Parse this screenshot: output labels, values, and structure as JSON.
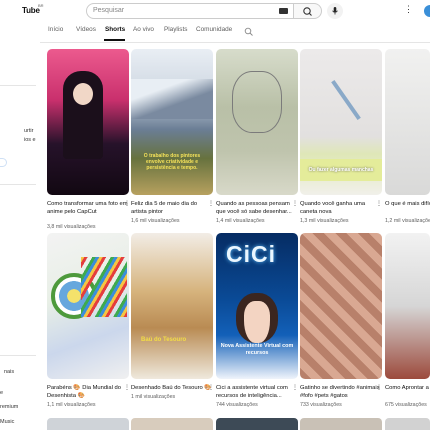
{
  "header": {
    "logo_text": "Tube",
    "logo_sup": "BR",
    "search_placeholder": "Pesquisar"
  },
  "tabs": [
    {
      "label": "Início",
      "active": false
    },
    {
      "label": "Vídeos",
      "active": false
    },
    {
      "label": "Shorts",
      "active": true
    },
    {
      "label": "Ao vivo",
      "active": false
    },
    {
      "label": "Playlists",
      "active": false
    },
    {
      "label": "Comunidade",
      "active": false
    }
  ],
  "sidebar": {
    "partial_texts": [
      "urtir",
      "ios e",
      "o",
      "nais",
      "e",
      "remium",
      "Music"
    ]
  },
  "shorts": [
    {
      "title": "Como transformar uma foto em anime pelo CapCut",
      "views": "3,8 mil visualizações"
    },
    {
      "title": "Feliz dia 5 de maio dia do artista pintor",
      "views": "1,6 mil visualizações",
      "overlay": "O trabalho dos pintores envolve criatividade e persistência e tempo."
    },
    {
      "title": "Quando as pessoas pensam que você só sabe desenhar...",
      "views": "1,4 mil visualizações"
    },
    {
      "title": "Quando você ganha uma caneta nova",
      "views": "1,3 mil visualizações",
      "overlay": "Ou fazer algumas manchas"
    },
    {
      "title": "O que é mais difícil de Desenhar?",
      "views": "1,2 mil visualizações"
    },
    {
      "title": "Parabéns 🎨 Dia Mundial do Desenhista 🎨",
      "views": "1,1 mil visualizações"
    },
    {
      "title": "Desenhado Baú do Tesouro 🎨",
      "views": "1 mil visualizações",
      "overlay": "Baú do Tesouro"
    },
    {
      "title": "Cici a assistente virtual com recursos de inteligência...",
      "views": "744 visualizações",
      "overlay_big": "CiCi",
      "overlay": "Nova Assistente Virtual com recursos"
    },
    {
      "title": "Gatinho se divertindo #animais #fofo #pets #gatos",
      "views": "733 visualizações"
    },
    {
      "title": "Como Aprontar a pr... aprontar o Lápis co...",
      "views": "675 visualizações"
    }
  ]
}
